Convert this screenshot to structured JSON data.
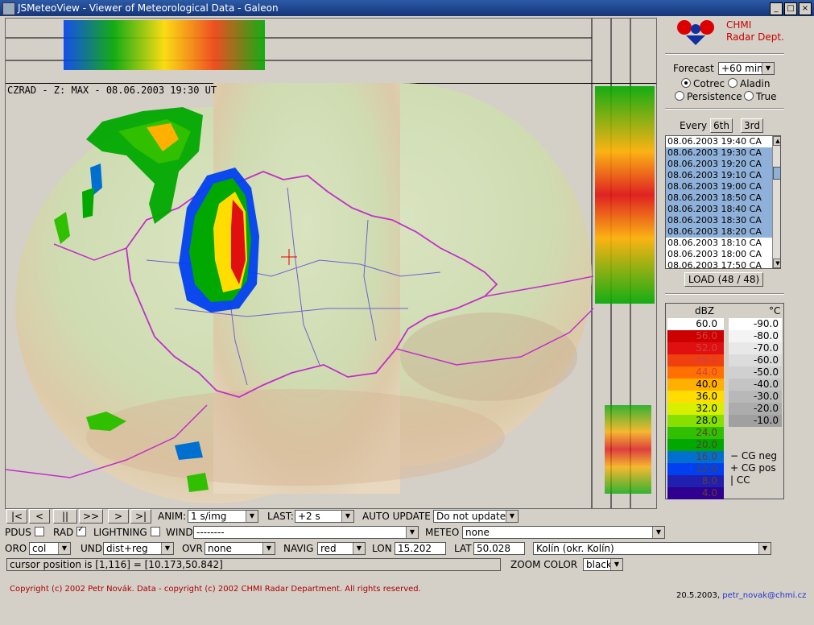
{
  "window": {
    "title": "JSMeteoView - Viewer of Meteorological Data - Galeon",
    "buttons": [
      "_",
      "□",
      "×"
    ]
  },
  "map": {
    "label": "CZRAD - Z: MAX - 08.06.2003 19:30 UT"
  },
  "logo": {
    "line1": "CHMI",
    "line2": "Radar Dept."
  },
  "forecast": {
    "label": "Forecast",
    "value": "+60 min",
    "options": [
      {
        "label": "Cotrec",
        "selected": true
      },
      {
        "label": "Aladin",
        "selected": false
      },
      {
        "label": "Persistence",
        "selected": false
      },
      {
        "label": "True",
        "selected": false
      }
    ]
  },
  "every": {
    "label": "Every",
    "btn1": "6th",
    "btn2": "3rd"
  },
  "image_list": {
    "items": [
      {
        "label": "08.06.2003 19:40 CA",
        "selected": false
      },
      {
        "label": "08.06.2003 19:30 CA",
        "selected": true
      },
      {
        "label": "08.06.2003 19:20 CA",
        "selected": true
      },
      {
        "label": "08.06.2003 19:10 CA",
        "selected": true
      },
      {
        "label": "08.06.2003 19:00 CA",
        "selected": true
      },
      {
        "label": "08.06.2003 18:50 CA",
        "selected": true
      },
      {
        "label": "08.06.2003 18:40 CA",
        "selected": true
      },
      {
        "label": "08.06.2003 18:30 CA",
        "selected": true
      },
      {
        "label": "08.06.2003 18:20 CA",
        "selected": true
      },
      {
        "label": "08.06.2003 18:10 CA",
        "selected": false
      },
      {
        "label": "08.06.2003 18:00 CA",
        "selected": false
      },
      {
        "label": "08.06.2003 17:50 CA",
        "selected": false
      }
    ],
    "load_label": "LOAD (48 / 48)"
  },
  "legend": {
    "dbz_header": "dBZ",
    "temp_header": "°C",
    "dbz": [
      {
        "v": "60.0",
        "c": "#ffffff"
      },
      {
        "v": "56.0",
        "c": "#cc0000"
      },
      {
        "v": "52.0",
        "c": "#e01010"
      },
      {
        "v": "48.0",
        "c": "#f04010"
      },
      {
        "v": "44.0",
        "c": "#ff7000"
      },
      {
        "v": "40.0",
        "c": "#ffb000"
      },
      {
        "v": "36.0",
        "c": "#ffdd00"
      },
      {
        "v": "32.0",
        "c": "#d8f000"
      },
      {
        "v": "28.0",
        "c": "#88e000"
      },
      {
        "v": "24.0",
        "c": "#30c000"
      },
      {
        "v": "20.0",
        "c": "#00a800"
      },
      {
        "v": "16.0",
        "c": "#0070d0"
      },
      {
        "v": "12.0",
        "c": "#0040f0"
      },
      {
        "v": "8.0",
        "c": "#2020b0"
      },
      {
        "v": "4.0",
        "c": "#300090"
      }
    ],
    "temps": [
      {
        "v": "-90.0",
        "c": "#ffffff"
      },
      {
        "v": "-80.0",
        "c": "#f4f4f4"
      },
      {
        "v": "-70.0",
        "c": "#e8e8e8"
      },
      {
        "v": "-60.0",
        "c": "#dcdcdc"
      },
      {
        "v": "-50.0",
        "c": "#d0d0d0"
      },
      {
        "v": "-40.0",
        "c": "#c4c4c4"
      },
      {
        "v": "-30.0",
        "c": "#b8b8b8"
      },
      {
        "v": "-20.0",
        "c": "#acacac"
      },
      {
        "v": "-10.0",
        "c": "#a0a0a0"
      }
    ],
    "cg_neg": "−  CG neg",
    "cg_pos": "+  CG pos",
    "cc": "|   CC"
  },
  "controls": {
    "anim_buttons": [
      "|<",
      "<",
      "||",
      ">>",
      ">",
      ">|"
    ],
    "anim_label": "ANIM:",
    "anim_value": "1 s/img",
    "last_label": "LAST:",
    "last_value": "+2 s",
    "auto_update_label": "AUTO UPDATE",
    "auto_update_value": "Do not update",
    "pdus_label": "PDUS",
    "rad_label": "RAD",
    "lightning_label": "LIGHTNING",
    "wind_label": "WIND",
    "wind_value": "--------",
    "meteo_label": "METEO",
    "meteo_value": "none",
    "oro_label": "ORO",
    "oro_value": "col",
    "und_label": "UND",
    "und_value": "dist+reg",
    "ovr_label": "OVR",
    "ovr_value": "none",
    "navig_label": "NAVIG",
    "navig_value": "red",
    "lon_label": "LON",
    "lon_value": "15.202",
    "lat_label": "LAT",
    "lat_value": "50.028",
    "place_value": "Kolín (okr. Kolín)",
    "cursor_text": "cursor position is [1,116] = [10.173,50.842]",
    "zoom_label": "ZOOM COLOR",
    "zoom_value": "black"
  },
  "footer": {
    "copyright": "Copyright (c) 2002 Petr Novák. Data - copyright (c) 2002 CHMI Radar Department. All rights reserved.",
    "date": "20.5.2003,",
    "email": "petr_novak@chmi.cz"
  }
}
